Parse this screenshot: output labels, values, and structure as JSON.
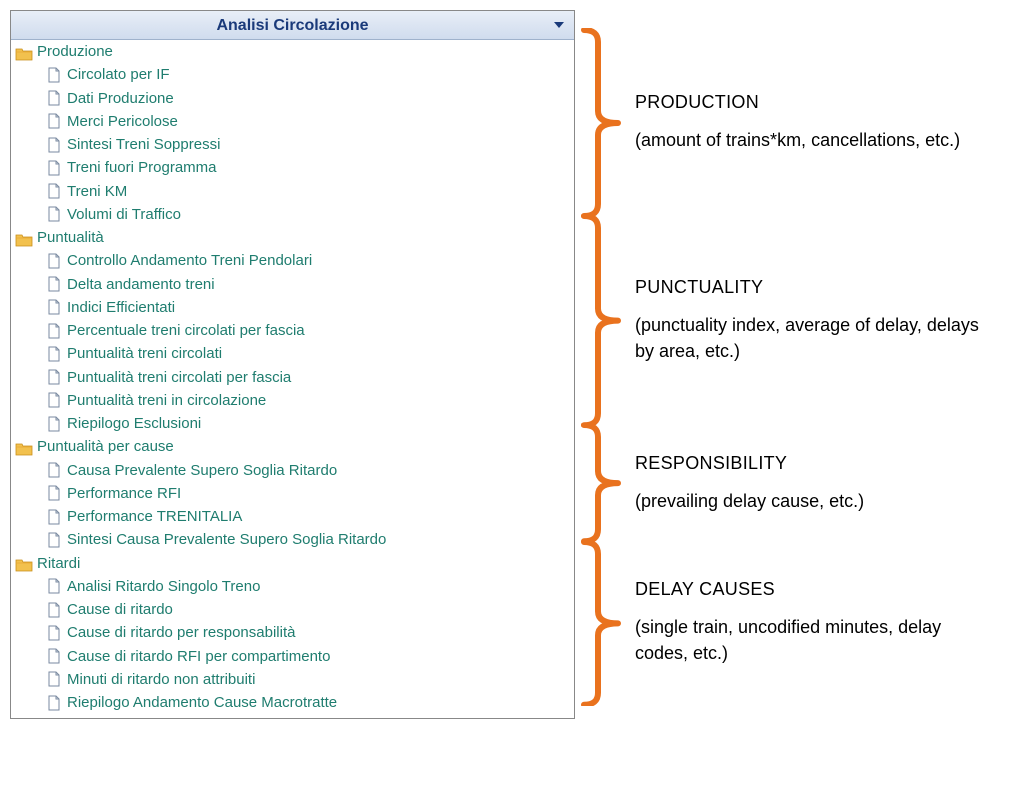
{
  "header": "Analisi Circolazione",
  "tree": [
    {
      "type": "folder",
      "label": "Produzione"
    },
    {
      "type": "item",
      "label": "Circolato per IF"
    },
    {
      "type": "item",
      "label": "Dati Produzione"
    },
    {
      "type": "item",
      "label": "Merci Pericolose"
    },
    {
      "type": "item",
      "label": "Sintesi Treni Soppressi"
    },
    {
      "type": "item",
      "label": "Treni fuori Programma"
    },
    {
      "type": "item",
      "label": "Treni KM"
    },
    {
      "type": "item",
      "label": "Volumi di Traffico"
    },
    {
      "type": "folder",
      "label": "Puntualità"
    },
    {
      "type": "item",
      "label": "Controllo Andamento Treni Pendolari"
    },
    {
      "type": "item",
      "label": "Delta andamento treni"
    },
    {
      "type": "item",
      "label": "Indici Efficientati"
    },
    {
      "type": "item",
      "label": "Percentuale treni circolati per fascia"
    },
    {
      "type": "item",
      "label": "Puntualità treni circolati"
    },
    {
      "type": "item",
      "label": "Puntualità treni circolati per fascia"
    },
    {
      "type": "item",
      "label": "Puntualità treni in circolazione"
    },
    {
      "type": "item",
      "label": "Riepilogo Esclusioni"
    },
    {
      "type": "folder",
      "label": "Puntualità per cause"
    },
    {
      "type": "item",
      "label": "Causa Prevalente Supero Soglia Ritardo"
    },
    {
      "type": "item",
      "label": "Performance RFI"
    },
    {
      "type": "item",
      "label": "Performance TRENITALIA"
    },
    {
      "type": "item",
      "label": "Sintesi Causa Prevalente Supero Soglia Ritardo"
    },
    {
      "type": "folder",
      "label": "Ritardi"
    },
    {
      "type": "item",
      "label": "Analisi Ritardo Singolo Treno"
    },
    {
      "type": "item",
      "label": "Cause di ritardo"
    },
    {
      "type": "item",
      "label": "Cause di ritardo per responsabilità"
    },
    {
      "type": "item",
      "label": "Cause di ritardo RFI per compartimento"
    },
    {
      "type": "item",
      "label": "Minuti di ritardo non attribuiti"
    },
    {
      "type": "item",
      "label": "Riepilogo Andamento Cause Macrotratte"
    }
  ],
  "callouts": {
    "production": {
      "title": "PRODUCTION",
      "desc": "(amount of trains*km, cancellations, etc.)"
    },
    "punctuality": {
      "title": "PUNCTUALITY",
      "desc": "(punctuality index, average of delay, delays by area, etc.)"
    },
    "responsibility": {
      "title": "RESPONSIBILITY",
      "desc": "(prevailing delay cause, etc.)"
    },
    "delay": {
      "title": "DELAY CAUSES",
      "desc": "(single train, uncodified minutes, delay codes, etc.)"
    }
  }
}
